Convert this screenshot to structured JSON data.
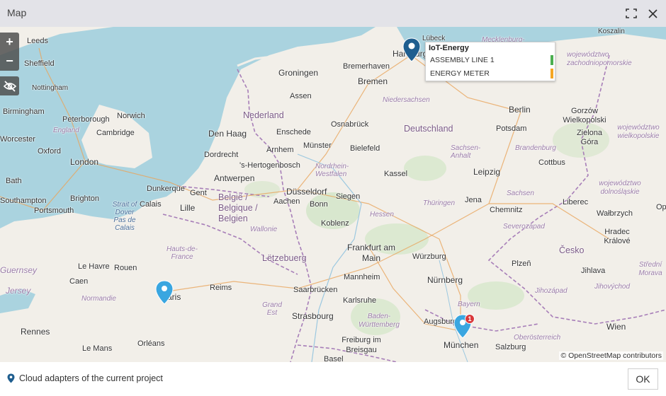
{
  "window": {
    "title": "Map"
  },
  "map": {
    "labels": [
      {
        "text": "Leeds",
        "type": "city"
      },
      {
        "text": "Sheffield",
        "type": "city"
      },
      {
        "text": "Nottingham",
        "type": "city"
      },
      {
        "text": "Birmingham",
        "type": "city"
      },
      {
        "text": "Peterborough",
        "type": "city"
      },
      {
        "text": "Norwich",
        "type": "city"
      },
      {
        "text": "England",
        "type": "region"
      },
      {
        "text": "Cambridge",
        "type": "city"
      },
      {
        "text": "Worcester",
        "type": "city"
      },
      {
        "text": "Oxford",
        "type": "city"
      },
      {
        "text": "London",
        "type": "city"
      },
      {
        "text": "Bath",
        "type": "city"
      },
      {
        "text": "Brighton",
        "type": "city"
      },
      {
        "text": "Southampton",
        "type": "city"
      },
      {
        "text": "Portsmouth",
        "type": "city"
      },
      {
        "text": "Strait of Dover Pas de Calais",
        "type": "sea"
      },
      {
        "text": "Calais",
        "type": "city"
      },
      {
        "text": "Dunkerque",
        "type": "city"
      },
      {
        "text": "Lille",
        "type": "city"
      },
      {
        "text": "Gent",
        "type": "city"
      },
      {
        "text": "Groningen",
        "type": "city"
      },
      {
        "text": "Assen",
        "type": "city"
      },
      {
        "text": "Nederland",
        "type": "country"
      },
      {
        "text": "Den Haag",
        "type": "city"
      },
      {
        "text": "Dordrecht",
        "type": "city"
      },
      {
        "text": "Enschede",
        "type": "city"
      },
      {
        "text": "Arnhem",
        "type": "city"
      },
      {
        "text": "'s-Hertogenbosch",
        "type": "city"
      },
      {
        "text": "Antwerpen",
        "type": "city"
      },
      {
        "text": "België / Belgique / Belgien",
        "type": "country"
      },
      {
        "text": "Wallonie",
        "type": "region"
      },
      {
        "text": "Aachen",
        "type": "city"
      },
      {
        "text": "Düsseldorf",
        "type": "city"
      },
      {
        "text": "Bonn",
        "type": "city"
      },
      {
        "text": "Koblenz",
        "type": "city"
      },
      {
        "text": "Lëtzebuerg",
        "type": "country"
      },
      {
        "text": "Bremerhaven",
        "type": "city"
      },
      {
        "text": "Bremen",
        "type": "city"
      },
      {
        "text": "Lübeck",
        "type": "city"
      },
      {
        "text": "Mecklenburg-",
        "type": "region"
      },
      {
        "text": "Koszalin",
        "type": "city"
      },
      {
        "text": "województwo zachodniopomorskie",
        "type": "region"
      },
      {
        "text": "Niedersachsen",
        "type": "region"
      },
      {
        "text": "Osnabrück",
        "type": "city"
      },
      {
        "text": "Deutschland",
        "type": "country"
      },
      {
        "text": "Münster",
        "type": "city"
      },
      {
        "text": "Bielefeld",
        "type": "city"
      },
      {
        "text": "Nordrhein-Westfalen",
        "type": "region"
      },
      {
        "text": "Kassel",
        "type": "city"
      },
      {
        "text": "Siegen",
        "type": "city"
      },
      {
        "text": "Hessen",
        "type": "region"
      },
      {
        "text": "Frankfurt am Main",
        "type": "city"
      },
      {
        "text": "Mannheim",
        "type": "city"
      },
      {
        "text": "Karlsruhe",
        "type": "city"
      },
      {
        "text": "Saarbrücken",
        "type": "city"
      },
      {
        "text": "Strasbourg",
        "type": "city"
      },
      {
        "text": "Reims",
        "type": "city"
      },
      {
        "text": "Rouen",
        "type": "city"
      },
      {
        "text": "Le Havre",
        "type": "city"
      },
      {
        "text": "Caen",
        "type": "city"
      },
      {
        "text": "Normandie",
        "type": "region"
      },
      {
        "text": "Hauts-de-France",
        "type": "region"
      },
      {
        "text": "Grand Est",
        "type": "region"
      },
      {
        "text": "Paris",
        "type": "city"
      },
      {
        "text": "Rennes",
        "type": "city"
      },
      {
        "text": "Le Mans",
        "type": "city"
      },
      {
        "text": "Orléans",
        "type": "city"
      },
      {
        "text": "Guernsey",
        "type": "region"
      },
      {
        "text": "Jersey",
        "type": "region"
      },
      {
        "text": "Berlin",
        "type": "city"
      },
      {
        "text": "Potsdam",
        "type": "city"
      },
      {
        "text": "Brandenburg",
        "type": "region"
      },
      {
        "text": "Sachsen-Anhalt",
        "type": "region"
      },
      {
        "text": "Leipzig",
        "type": "city"
      },
      {
        "text": "Cottbus",
        "type": "city"
      },
      {
        "text": "Sachsen",
        "type": "region"
      },
      {
        "text": "Thüringen",
        "type": "region"
      },
      {
        "text": "Jena",
        "type": "city"
      },
      {
        "text": "Chemnitz",
        "type": "city"
      },
      {
        "text": "Gorzów Wielkopolski",
        "type": "city"
      },
      {
        "text": "Zielona Góra",
        "type": "city"
      },
      {
        "text": "województwo wielkopolskie",
        "type": "region"
      },
      {
        "text": "województwo dolnośląskie",
        "type": "region"
      },
      {
        "text": "Liberec",
        "type": "city"
      },
      {
        "text": "Wałbrzych",
        "type": "city"
      },
      {
        "text": "Severozápad",
        "type": "region"
      },
      {
        "text": "Hradec Králové",
        "type": "city"
      },
      {
        "text": "Česko",
        "type": "country"
      },
      {
        "text": "Plzeň",
        "type": "city"
      },
      {
        "text": "Jihlava",
        "type": "city"
      },
      {
        "text": "Jihozápad",
        "type": "region"
      },
      {
        "text": "Jihovýchod",
        "type": "region"
      },
      {
        "text": "Střední Morava",
        "type": "region"
      },
      {
        "text": "Würzburg",
        "type": "city"
      },
      {
        "text": "Nürnberg",
        "type": "city"
      },
      {
        "text": "Baden-Württemberg",
        "type": "region"
      },
      {
        "text": "Bayern",
        "type": "region"
      },
      {
        "text": "Augsburg",
        "type": "city"
      },
      {
        "text": "München",
        "type": "city"
      },
      {
        "text": "Freiburg im Breisgau",
        "type": "city"
      },
      {
        "text": "Basel",
        "type": "city"
      },
      {
        "text": "Salzburg",
        "type": "city"
      },
      {
        "text": "Oberösterreich",
        "type": "region"
      },
      {
        "text": "Wien",
        "type": "city"
      },
      {
        "text": "Hamburg",
        "type": "city"
      },
      {
        "text": "Op",
        "type": "city"
      }
    ],
    "zoom_in_label": "+",
    "zoom_out_label": "−",
    "attribution": "© OpenStreetMap contributors",
    "markers": [
      {
        "name": "hamburg",
        "color": "#1f5e8f"
      },
      {
        "name": "paris",
        "color": "#3aa6e0"
      },
      {
        "name": "munich",
        "color": "#3aa6e0",
        "badge": "1"
      }
    ],
    "popup": {
      "title": "IoT-Energy",
      "rows": [
        {
          "label": "ASSEMBLY LINE 1",
          "status_color": "#4caf50"
        },
        {
          "label": "ENERGY METER",
          "status_color": "#f5a623"
        }
      ]
    }
  },
  "footer": {
    "legend_label": "Cloud adapters of the current project",
    "ok_label": "OK"
  }
}
